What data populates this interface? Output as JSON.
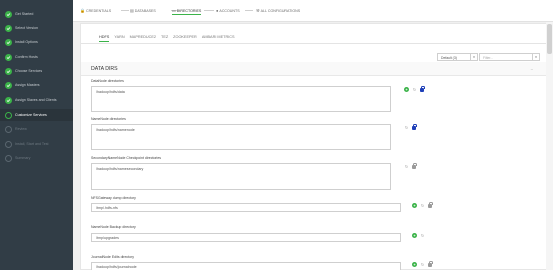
{
  "sidebar": {
    "steps": [
      {
        "label": "Get Started",
        "state": "done"
      },
      {
        "label": "Select Version",
        "state": "done"
      },
      {
        "label": "Install Options",
        "state": "done"
      },
      {
        "label": "Confirm Hosts",
        "state": "done"
      },
      {
        "label": "Choose Services",
        "state": "done"
      },
      {
        "label": "Assign Masters",
        "state": "done"
      },
      {
        "label": "Assign Slaves and Clients",
        "state": "done"
      },
      {
        "label": "Customize Services",
        "state": "current"
      },
      {
        "label": "Review",
        "state": "todo"
      },
      {
        "label": "Install, Start and Test",
        "state": "todo"
      },
      {
        "label": "Summary",
        "state": "todo"
      }
    ]
  },
  "breadcrumb": {
    "items": [
      {
        "label": "CREDENTIALS",
        "icon": "lock-icon"
      },
      {
        "label": "DATABASES",
        "icon": "database-icon"
      },
      {
        "label": "DIRECTORIES",
        "icon": "folder-icon"
      },
      {
        "label": "ACCOUNTS",
        "icon": "user-icon"
      },
      {
        "label": "ALL CONFIGURATIONS",
        "icon": "wrench-icon"
      }
    ]
  },
  "tabs": [
    "HDFS",
    "YARN",
    "MAPREDUCE2",
    "TEZ",
    "ZOOKEEPER",
    "AMBARI METRICS"
  ],
  "filter": {
    "group_value": "Default (3)",
    "search_placeholder": "Filter..."
  },
  "section": {
    "title": "DATA DIRS"
  },
  "fields": [
    {
      "label": "DataNode directories",
      "value": "/hadoop/hdfs/data"
    },
    {
      "label": "NameNode directories",
      "value": "/hadoop/hdfs/namenode"
    },
    {
      "label": "SecondaryNameNode Checkpoint directories",
      "value": "/hadoop/hdfs/namesecondary"
    },
    {
      "label": "NFSGateway dump directory",
      "value": "/tmp/.hdfs-nfs"
    },
    {
      "label": "NameNode Backup directory",
      "value": "/tmp/upgrades"
    },
    {
      "label": "JournalNode Edits directory",
      "value": "/hadoop/hdfs/journalnode"
    }
  ],
  "colors": {
    "sidebar_bg": "#313d46",
    "accent_green": "#3bb349",
    "lock_blue": "#1e3fb8"
  }
}
